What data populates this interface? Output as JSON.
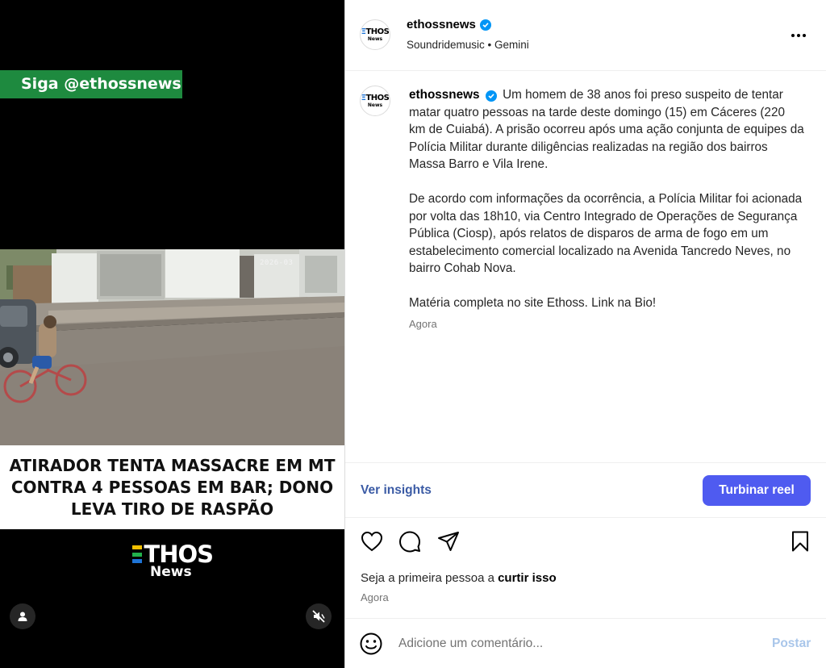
{
  "media": {
    "banner": "Siga @ethossnews",
    "video_timestamp": "2026-03",
    "headline": "ATIRADOR TENTA MASSACRE EM MT CONTRA 4 PESSOAS EM BAR; DONO LEVA TIRO DE RASPÃO",
    "brand_top": "THOS",
    "brand_bottom": "News",
    "icons": {
      "user": "user-icon",
      "mute": "muted-speaker-icon"
    }
  },
  "header": {
    "avatar_text_top": "THOS",
    "avatar_text_bottom": "News",
    "username": "ethossnews",
    "subtitle": "Soundridemusic • Gemini",
    "more_icon": "more-horizontal-icon"
  },
  "caption": {
    "username": "ethossnews",
    "paragraphs": [
      "Um homem de 38 anos foi preso suspeito de tentar matar quatro pessoas na tarde deste domingo (15) em Cáceres (220 km de Cuiabá). A prisão ocorreu após uma ação conjunta de equipes da Polícia Militar durante diligências realizadas na região dos bairros Massa Barro e Vila Irene.",
      "De acordo com informações da ocorrência, a Polícia Militar foi acionada por volta das 18h10, via Centro Integrado de Operações de Segurança Pública (Ciosp), após relatos de disparos de arma de fogo em um estabelecimento comercial localizado na Avenida Tancredo Neves, no bairro Cohab Nova.",
      "Matéria completa no site Ethoss. Link na Bio!"
    ],
    "time": "Agora"
  },
  "insights": {
    "link_label": "Ver insights",
    "boost_label": "Turbinar reel"
  },
  "actions": {
    "icons": [
      "heart-icon",
      "comment-icon",
      "share-icon",
      "bookmark-icon"
    ],
    "likes_prefix": "Seja a primeira pessoa a ",
    "likes_action": "curtir isso",
    "time": "Agora"
  },
  "comment": {
    "placeholder": "Adicione um comentário...",
    "post_label": "Postar",
    "emoji_icon": "emoji-icon"
  },
  "colors": {
    "banner_green": "#1e8a3f",
    "boost_blue": "#4f5bf0",
    "verified_blue": "#0095f6"
  }
}
